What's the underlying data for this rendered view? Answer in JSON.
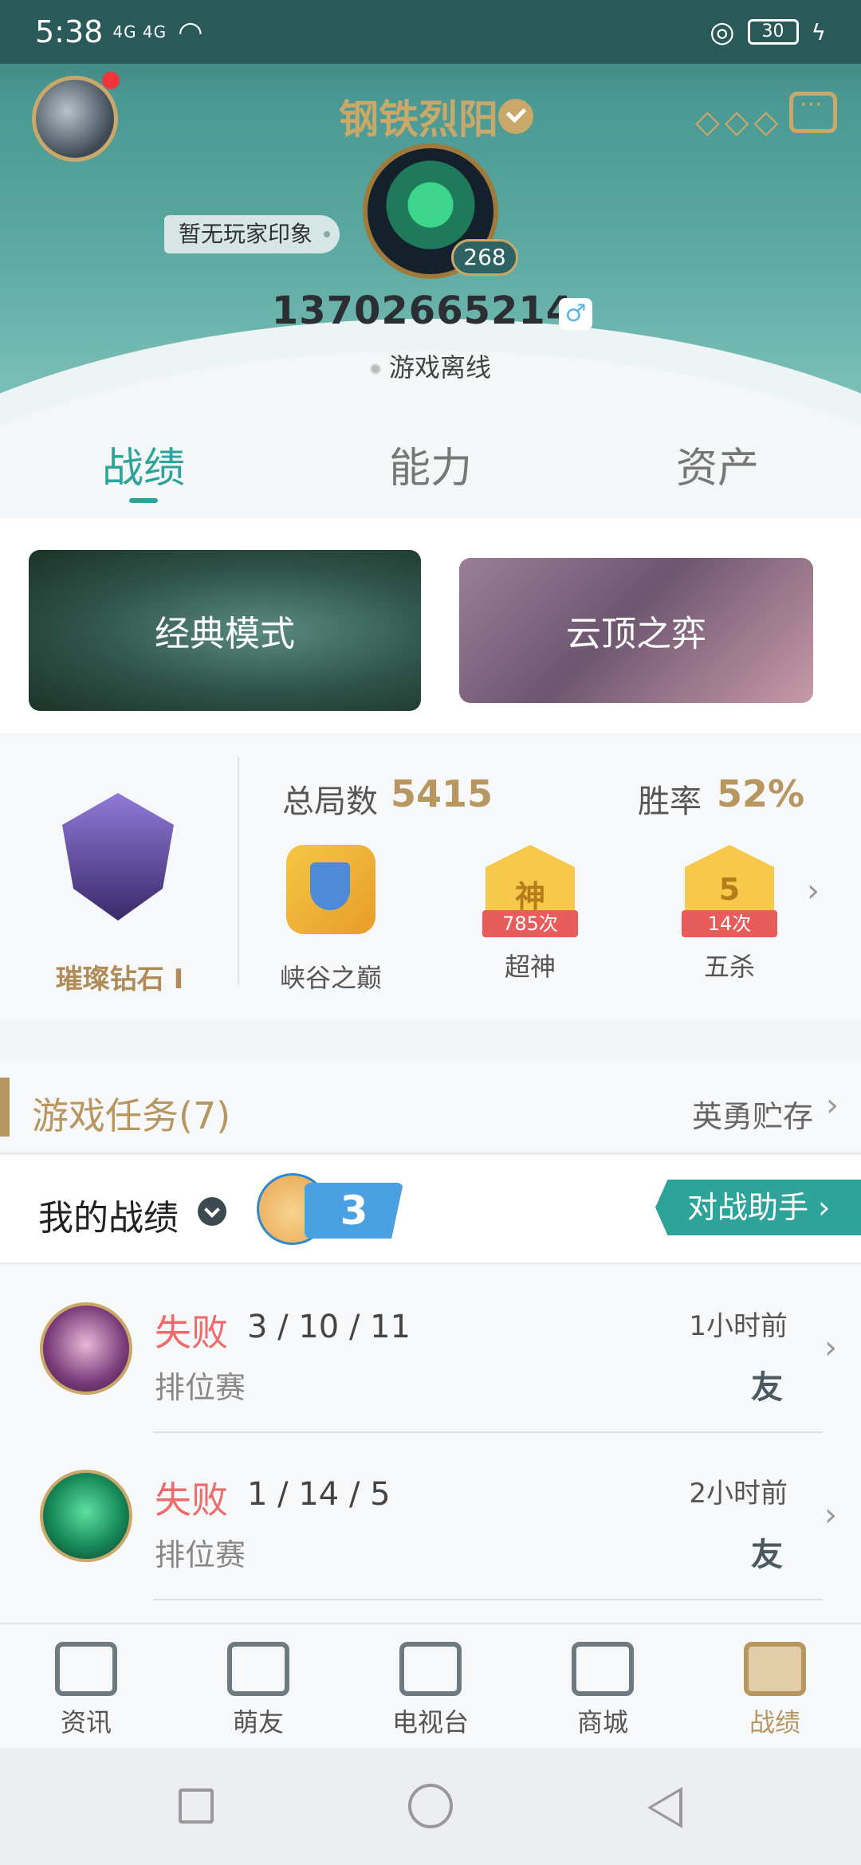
{
  "status_bar": {
    "time": "5:38",
    "network": "4G 4G",
    "battery": "30"
  },
  "profile": {
    "username": "钢铁烈阳",
    "level": "268",
    "impression": "暂无玩家印象",
    "player_id": "13702665214",
    "status": "游戏离线"
  },
  "tabs": [
    "战绩",
    "能力",
    "资产"
  ],
  "modes": {
    "classic": "经典模式",
    "tft": "云顶之弈"
  },
  "rank": {
    "tier": "璀璨钻石 I",
    "total_label": "总局数",
    "total_value": "5415",
    "winrate_label": "胜率",
    "winrate_value": "52%",
    "badges": [
      {
        "label": "峡谷之巅",
        "count": "",
        "glyph": ""
      },
      {
        "label": "超神",
        "count": "785次",
        "glyph": "神"
      },
      {
        "label": "五杀",
        "count": "14次",
        "glyph": "5"
      }
    ]
  },
  "tasks": {
    "title": "游戏任务(7)",
    "link": "英勇贮存"
  },
  "record": {
    "title": "我的战绩",
    "streak": "3",
    "assistant": "对战助手 ›"
  },
  "matches": [
    {
      "result": "失败",
      "kda": "3 / 10 / 11",
      "type": "排位赛",
      "time": "1小时前",
      "tag": "友"
    },
    {
      "result": "失败",
      "kda": "1 / 14 / 5",
      "type": "排位赛",
      "time": "2小时前",
      "tag": "友"
    }
  ],
  "nav": [
    "资讯",
    "萌友",
    "电视台",
    "商城",
    "战绩"
  ]
}
